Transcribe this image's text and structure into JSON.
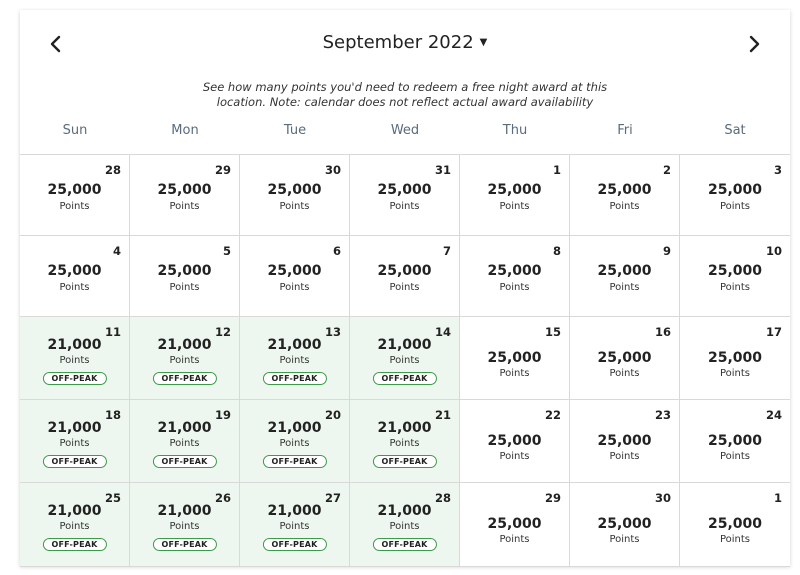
{
  "header": {
    "month_title": "September 2022",
    "prev_icon": "chevron-left-icon",
    "next_icon": "chevron-right-icon",
    "caret_icon": "caret-down-icon"
  },
  "note": {
    "line1": "See how many points you'd need to redeem a free night award at this",
    "line2": "location. Note: calendar does not reflect actual award availability"
  },
  "weekdays": [
    "Sun",
    "Mon",
    "Tue",
    "Wed",
    "Thu",
    "Fri",
    "Sat"
  ],
  "points_label": "Points",
  "offpeak_label": "OFF-PEAK",
  "colors": {
    "offpeak_bg": "#eef7ef",
    "offpeak_border": "#3e9a4a",
    "weekday_text": "#5a6b7b"
  },
  "weeks": [
    [
      {
        "day": "28",
        "points": "25,000",
        "offpeak": false
      },
      {
        "day": "29",
        "points": "25,000",
        "offpeak": false
      },
      {
        "day": "30",
        "points": "25,000",
        "offpeak": false
      },
      {
        "day": "31",
        "points": "25,000",
        "offpeak": false
      },
      {
        "day": "1",
        "points": "25,000",
        "offpeak": false
      },
      {
        "day": "2",
        "points": "25,000",
        "offpeak": false
      },
      {
        "day": "3",
        "points": "25,000",
        "offpeak": false
      }
    ],
    [
      {
        "day": "4",
        "points": "25,000",
        "offpeak": false
      },
      {
        "day": "5",
        "points": "25,000",
        "offpeak": false
      },
      {
        "day": "6",
        "points": "25,000",
        "offpeak": false
      },
      {
        "day": "7",
        "points": "25,000",
        "offpeak": false
      },
      {
        "day": "8",
        "points": "25,000",
        "offpeak": false
      },
      {
        "day": "9",
        "points": "25,000",
        "offpeak": false
      },
      {
        "day": "10",
        "points": "25,000",
        "offpeak": false
      }
    ],
    [
      {
        "day": "11",
        "points": "21,000",
        "offpeak": true
      },
      {
        "day": "12",
        "points": "21,000",
        "offpeak": true
      },
      {
        "day": "13",
        "points": "21,000",
        "offpeak": true
      },
      {
        "day": "14",
        "points": "21,000",
        "offpeak": true
      },
      {
        "day": "15",
        "points": "25,000",
        "offpeak": false
      },
      {
        "day": "16",
        "points": "25,000",
        "offpeak": false
      },
      {
        "day": "17",
        "points": "25,000",
        "offpeak": false
      }
    ],
    [
      {
        "day": "18",
        "points": "21,000",
        "offpeak": true
      },
      {
        "day": "19",
        "points": "21,000",
        "offpeak": true
      },
      {
        "day": "20",
        "points": "21,000",
        "offpeak": true
      },
      {
        "day": "21",
        "points": "21,000",
        "offpeak": true
      },
      {
        "day": "22",
        "points": "25,000",
        "offpeak": false
      },
      {
        "day": "23",
        "points": "25,000",
        "offpeak": false
      },
      {
        "day": "24",
        "points": "25,000",
        "offpeak": false
      }
    ],
    [
      {
        "day": "25",
        "points": "21,000",
        "offpeak": true
      },
      {
        "day": "26",
        "points": "21,000",
        "offpeak": true
      },
      {
        "day": "27",
        "points": "21,000",
        "offpeak": true
      },
      {
        "day": "28",
        "points": "21,000",
        "offpeak": true
      },
      {
        "day": "29",
        "points": "25,000",
        "offpeak": false
      },
      {
        "day": "30",
        "points": "25,000",
        "offpeak": false
      },
      {
        "day": "1",
        "points": "25,000",
        "offpeak": false
      }
    ]
  ]
}
